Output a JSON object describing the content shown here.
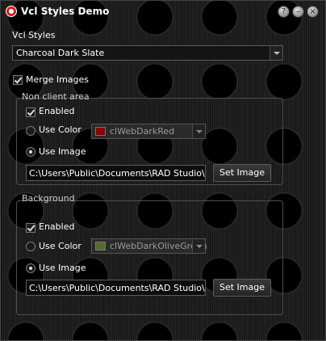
{
  "window": {
    "title": "Vcl Styles Demo"
  },
  "vcl_styles": {
    "label": "Vcl Styles",
    "selected": "Charcoal Dark Slate",
    "merge_images_label": "Merge Images",
    "merge_images_checked": true
  },
  "non_client": {
    "legend": "Non client area",
    "enabled_label": "Enabled",
    "use_color_label": "Use Color",
    "color_value": "clWebDarkRed",
    "color_swatch": "#8b0000",
    "use_image_label": "Use Image",
    "image_path": "C:\\Users\\Public\\Documents\\RAD Studio\\Projects",
    "set_image_label": "Set Image"
  },
  "background": {
    "legend": "Background",
    "enabled_label": "Enabled",
    "use_color_label": "Use Color",
    "color_value": "clWebDarkOliveGreen",
    "color_swatch": "#556b2f",
    "use_image_label": "Use Image",
    "image_path": "C:\\Users\\Public\\Documents\\RAD Studio\\Projects",
    "set_image_label": "Set Image"
  },
  "icons": {
    "app": "app-logo-icon",
    "help": "help-icon",
    "minimize": "minimize-icon",
    "close": "close-icon"
  }
}
